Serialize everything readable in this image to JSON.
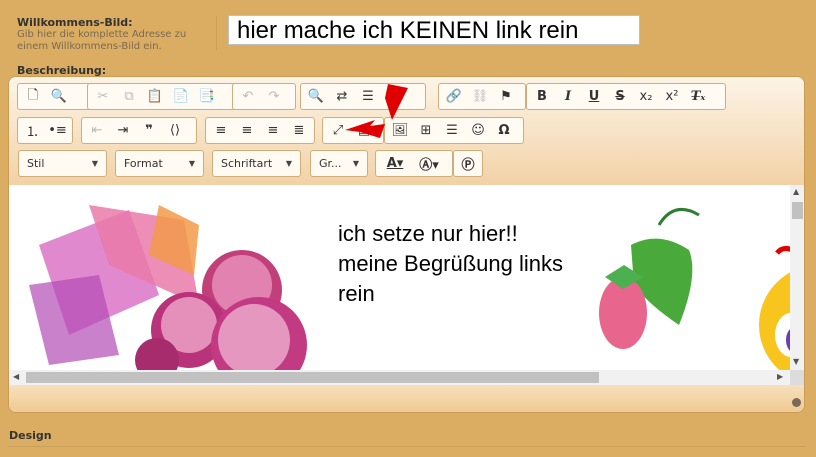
{
  "welcome": {
    "label": "Willkommens-Bild:",
    "help": "Gib hier die komplette Adresse zu einem Willkommens-Bild ein.",
    "input_value": "hier mache ich KEINEN  link  rein"
  },
  "description": {
    "label": "Beschreibung:"
  },
  "toolbar": {
    "combos": {
      "style": "Stil",
      "format": "Format",
      "font": "Schriftart",
      "size": "Gr..."
    }
  },
  "content": {
    "line1": "ich setze  nur hier!!",
    "line2": "meine Begrüßung links",
    "line3": "rein"
  },
  "design": {
    "label": "Design"
  },
  "colors": {
    "background": "#dbad62",
    "toolbar": "#f6dcb8",
    "arrow": "#e00000"
  }
}
